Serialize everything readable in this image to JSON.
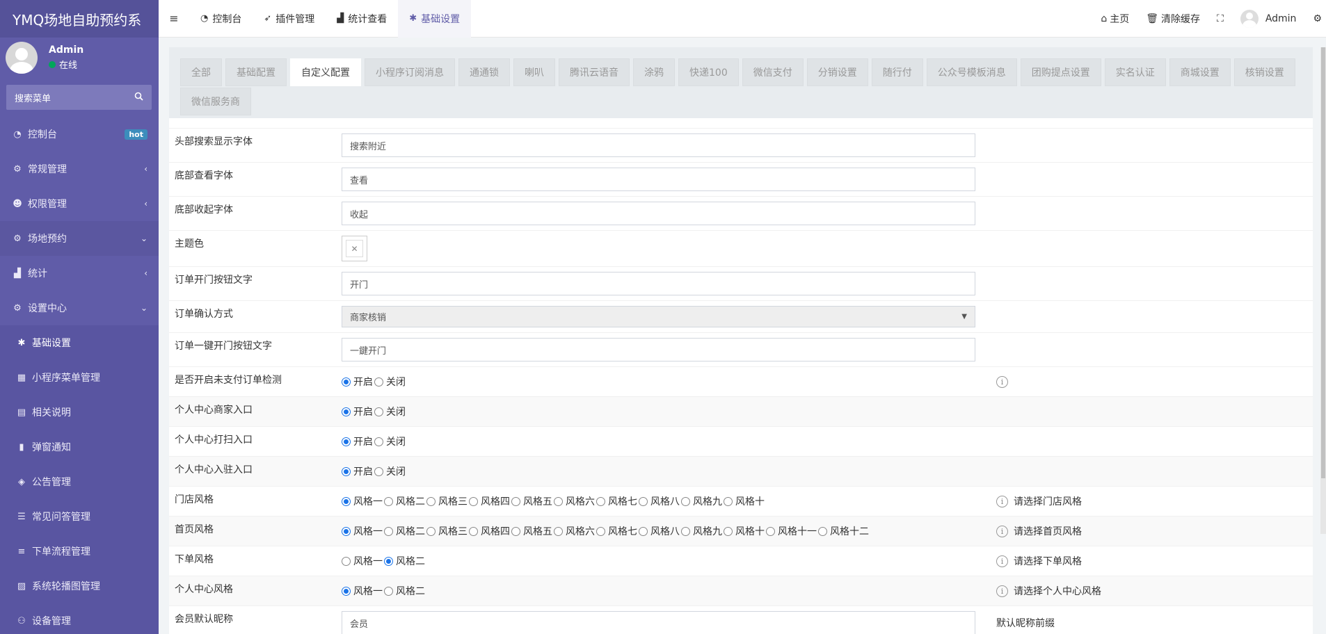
{
  "app": {
    "title": "YMQ场地自助预约系"
  },
  "user": {
    "name": "Admin",
    "status": "在线"
  },
  "sidebar": {
    "search_placeholder": "搜索菜单",
    "items": [
      {
        "label": "控制台",
        "icon": "dashboard-icon",
        "badge": "hot"
      },
      {
        "label": "常规管理",
        "icon": "cogs-icon",
        "arrow": "‹"
      },
      {
        "label": "权限管理",
        "icon": "group-icon",
        "arrow": "‹"
      },
      {
        "label": "场地预约",
        "icon": "cogs-icon",
        "arrow": "⌄"
      },
      {
        "label": "统计",
        "icon": "chart-icon",
        "arrow": "‹"
      },
      {
        "label": "设置中心",
        "icon": "cogs-icon",
        "arrow": "⌄"
      }
    ],
    "subitems": [
      {
        "label": "基础设置",
        "icon": "asterisk-icon"
      },
      {
        "label": "小程序菜单管理",
        "icon": "grid-icon"
      },
      {
        "label": "相关说明",
        "icon": "file-icon"
      },
      {
        "label": "弹窗通知",
        "icon": "bookmark-icon"
      },
      {
        "label": "公告管理",
        "icon": "shield-icon"
      },
      {
        "label": "常见问答管理",
        "icon": "list-icon"
      },
      {
        "label": "下单流程管理",
        "icon": "bars-icon"
      },
      {
        "label": "系统轮播图管理",
        "icon": "image-icon"
      },
      {
        "label": "设备管理",
        "icon": "device-icon"
      }
    ]
  },
  "navbar": {
    "tabs": [
      {
        "label": "控制台",
        "icon": "dashboard-icon"
      },
      {
        "label": "插件管理",
        "icon": "rocket-icon"
      },
      {
        "label": "统计查看",
        "icon": "area-chart-icon"
      },
      {
        "label": "基础设置",
        "icon": "asterisk-icon"
      }
    ],
    "right": {
      "home": "主页",
      "clear_cache": "清除缓存",
      "admin": "Admin"
    }
  },
  "config_tabs": [
    "全部",
    "基础配置",
    "自定义配置",
    "小程序订阅消息",
    "通通锁",
    "喇叭",
    "腾讯云语音",
    "涂鸦",
    "快递100",
    "微信支付",
    "分销设置",
    "随行付",
    "公众号模板消息",
    "团购提点设置",
    "实名认证",
    "商城设置",
    "核销设置",
    "微信服务商"
  ],
  "form": {
    "search_font": {
      "label": "头部搜索显示字体",
      "value": "搜索附近"
    },
    "view_font": {
      "label": "底部查看字体",
      "value": "查看"
    },
    "collapse_font": {
      "label": "底部收起字体",
      "value": "收起"
    },
    "theme_color": {
      "label": "主题色"
    },
    "open_door_text": {
      "label": "订单开门按钮文字",
      "value": "开门"
    },
    "confirm_method": {
      "label": "订单确认方式",
      "value": "商家核销"
    },
    "one_key_text": {
      "label": "订单一键开门按钮文字",
      "value": "一鍵开门"
    },
    "unpaid_check": {
      "label": "是否开启未支付订单检测",
      "on": "开启",
      "off": "关闭"
    },
    "merchant_entry": {
      "label": "个人中心商家入口",
      "on": "开启",
      "off": "关闭"
    },
    "clean_entry": {
      "label": "个人中心打扫入口",
      "on": "开启",
      "off": "关闭"
    },
    "join_entry": {
      "label": "个人中心入驻入口",
      "on": "开启",
      "off": "关闭"
    },
    "store_style": {
      "label": "门店风格",
      "hint": "请选择门店风格",
      "options": [
        "风格一",
        "风格二",
        "风格三",
        "风格四",
        "风格五",
        "风格六",
        "风格七",
        "风格八",
        "风格九",
        "风格十"
      ]
    },
    "home_style": {
      "label": "首页风格",
      "hint": "请选择首页风格",
      "options": [
        "风格一",
        "风格二",
        "风格三",
        "风格四",
        "风格五",
        "风格六",
        "风格七",
        "风格八",
        "风格九",
        "风格十",
        "风格十一",
        "风格十二"
      ]
    },
    "order_style": {
      "label": "下单风格",
      "hint": "请选择下单风格",
      "options": [
        "风格一",
        "风格二"
      ]
    },
    "center_style": {
      "label": "个人中心风格",
      "hint": "请选择个人中心风格",
      "options": [
        "风格一",
        "风格二"
      ]
    },
    "member_nickname": {
      "label": "会员默认昵称",
      "value": "会员",
      "hint": "默认昵称前缀"
    }
  }
}
